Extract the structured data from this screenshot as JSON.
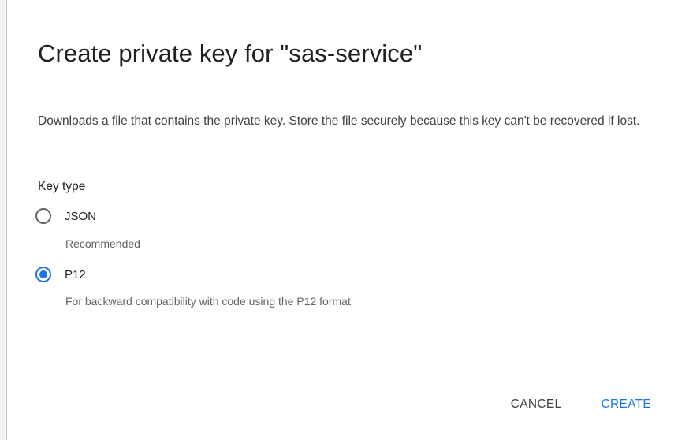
{
  "dialog": {
    "title": "Create private key for \"sas-service\"",
    "description": "Downloads a file that contains the private key. Store the file securely because this key can't be recovered if lost.",
    "key_type_label": "Key type",
    "options": [
      {
        "label": "JSON",
        "hint": "Recommended",
        "selected": false
      },
      {
        "label": "P12",
        "hint": "For backward compatibility with code using the P12 format",
        "selected": true
      }
    ],
    "actions": {
      "cancel_label": "CANCEL",
      "create_label": "CREATE"
    }
  },
  "colors": {
    "accent": "#1a73e8",
    "text_primary": "#202124",
    "text_secondary": "#5f6368"
  }
}
